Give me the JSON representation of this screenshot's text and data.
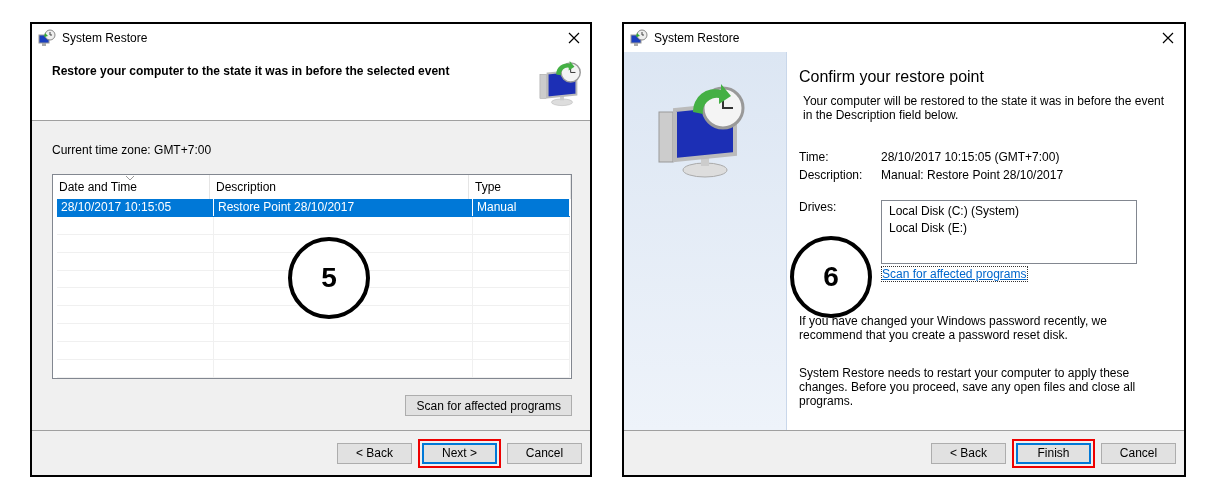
{
  "dialogs": [
    {
      "kind": "select",
      "title": "System Restore",
      "heading": "Restore your computer to the state it was in before the selected event",
      "timezone": "Current time zone: GMT+7:00",
      "table": {
        "columns": [
          {
            "label": "Date and Time",
            "sorted": true
          },
          {
            "label": "Description",
            "sorted": false
          },
          {
            "label": "Type",
            "sorted": false
          }
        ],
        "rows": [
          {
            "cells": [
              "28/10/2017 10:15:05",
              "Restore Point 28/10/2017",
              "Manual"
            ],
            "selected": true
          }
        ]
      },
      "scan_button": "Scan for affected programs",
      "step": "5",
      "buttons": [
        {
          "label": "< Back",
          "focused": false
        },
        {
          "label": "Next >",
          "focused": true
        },
        {
          "label": "Cancel",
          "focused": false
        }
      ]
    },
    {
      "kind": "confirm",
      "title": "System Restore",
      "heading": "Confirm your restore point",
      "intro": "Your computer will be restored to the state it was in before the event in the Description field below.",
      "fields": [
        {
          "label": "Time:",
          "value": "28/10/2017 10:15:05 (GMT+7:00)"
        },
        {
          "label": "Description:",
          "value": "Manual: Restore Point 28/10/2017"
        }
      ],
      "drives_label": "Drives:",
      "drives": [
        "Local Disk (C:) (System)",
        "Local Disk (E:)"
      ],
      "scan_link": "Scan for affected programs",
      "step": "6",
      "notes": [
        "If you have changed your Windows password recently, we recommend that you create a password reset disk.",
        "System Restore needs to restart your computer to apply these changes. Before you proceed, save any open files and close all programs."
      ],
      "buttons": [
        {
          "label": "< Back",
          "focused": false
        },
        {
          "label": "Finish",
          "focused": true
        },
        {
          "label": "Cancel",
          "focused": false
        }
      ]
    }
  ]
}
